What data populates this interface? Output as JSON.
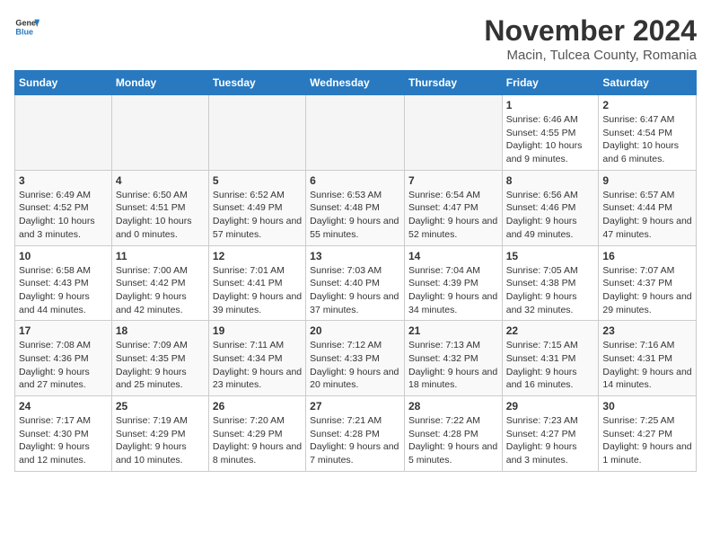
{
  "header": {
    "logo_general": "General",
    "logo_blue": "Blue",
    "month": "November 2024",
    "location": "Macin, Tulcea County, Romania"
  },
  "weekdays": [
    "Sunday",
    "Monday",
    "Tuesday",
    "Wednesday",
    "Thursday",
    "Friday",
    "Saturday"
  ],
  "weeks": [
    [
      {
        "day": "",
        "info": ""
      },
      {
        "day": "",
        "info": ""
      },
      {
        "day": "",
        "info": ""
      },
      {
        "day": "",
        "info": ""
      },
      {
        "day": "",
        "info": ""
      },
      {
        "day": "1",
        "info": "Sunrise: 6:46 AM\nSunset: 4:55 PM\nDaylight: 10 hours and 9 minutes."
      },
      {
        "day": "2",
        "info": "Sunrise: 6:47 AM\nSunset: 4:54 PM\nDaylight: 10 hours and 6 minutes."
      }
    ],
    [
      {
        "day": "3",
        "info": "Sunrise: 6:49 AM\nSunset: 4:52 PM\nDaylight: 10 hours and 3 minutes."
      },
      {
        "day": "4",
        "info": "Sunrise: 6:50 AM\nSunset: 4:51 PM\nDaylight: 10 hours and 0 minutes."
      },
      {
        "day": "5",
        "info": "Sunrise: 6:52 AM\nSunset: 4:49 PM\nDaylight: 9 hours and 57 minutes."
      },
      {
        "day": "6",
        "info": "Sunrise: 6:53 AM\nSunset: 4:48 PM\nDaylight: 9 hours and 55 minutes."
      },
      {
        "day": "7",
        "info": "Sunrise: 6:54 AM\nSunset: 4:47 PM\nDaylight: 9 hours and 52 minutes."
      },
      {
        "day": "8",
        "info": "Sunrise: 6:56 AM\nSunset: 4:46 PM\nDaylight: 9 hours and 49 minutes."
      },
      {
        "day": "9",
        "info": "Sunrise: 6:57 AM\nSunset: 4:44 PM\nDaylight: 9 hours and 47 minutes."
      }
    ],
    [
      {
        "day": "10",
        "info": "Sunrise: 6:58 AM\nSunset: 4:43 PM\nDaylight: 9 hours and 44 minutes."
      },
      {
        "day": "11",
        "info": "Sunrise: 7:00 AM\nSunset: 4:42 PM\nDaylight: 9 hours and 42 minutes."
      },
      {
        "day": "12",
        "info": "Sunrise: 7:01 AM\nSunset: 4:41 PM\nDaylight: 9 hours and 39 minutes."
      },
      {
        "day": "13",
        "info": "Sunrise: 7:03 AM\nSunset: 4:40 PM\nDaylight: 9 hours and 37 minutes."
      },
      {
        "day": "14",
        "info": "Sunrise: 7:04 AM\nSunset: 4:39 PM\nDaylight: 9 hours and 34 minutes."
      },
      {
        "day": "15",
        "info": "Sunrise: 7:05 AM\nSunset: 4:38 PM\nDaylight: 9 hours and 32 minutes."
      },
      {
        "day": "16",
        "info": "Sunrise: 7:07 AM\nSunset: 4:37 PM\nDaylight: 9 hours and 29 minutes."
      }
    ],
    [
      {
        "day": "17",
        "info": "Sunrise: 7:08 AM\nSunset: 4:36 PM\nDaylight: 9 hours and 27 minutes."
      },
      {
        "day": "18",
        "info": "Sunrise: 7:09 AM\nSunset: 4:35 PM\nDaylight: 9 hours and 25 minutes."
      },
      {
        "day": "19",
        "info": "Sunrise: 7:11 AM\nSunset: 4:34 PM\nDaylight: 9 hours and 23 minutes."
      },
      {
        "day": "20",
        "info": "Sunrise: 7:12 AM\nSunset: 4:33 PM\nDaylight: 9 hours and 20 minutes."
      },
      {
        "day": "21",
        "info": "Sunrise: 7:13 AM\nSunset: 4:32 PM\nDaylight: 9 hours and 18 minutes."
      },
      {
        "day": "22",
        "info": "Sunrise: 7:15 AM\nSunset: 4:31 PM\nDaylight: 9 hours and 16 minutes."
      },
      {
        "day": "23",
        "info": "Sunrise: 7:16 AM\nSunset: 4:31 PM\nDaylight: 9 hours and 14 minutes."
      }
    ],
    [
      {
        "day": "24",
        "info": "Sunrise: 7:17 AM\nSunset: 4:30 PM\nDaylight: 9 hours and 12 minutes."
      },
      {
        "day": "25",
        "info": "Sunrise: 7:19 AM\nSunset: 4:29 PM\nDaylight: 9 hours and 10 minutes."
      },
      {
        "day": "26",
        "info": "Sunrise: 7:20 AM\nSunset: 4:29 PM\nDaylight: 9 hours and 8 minutes."
      },
      {
        "day": "27",
        "info": "Sunrise: 7:21 AM\nSunset: 4:28 PM\nDaylight: 9 hours and 7 minutes."
      },
      {
        "day": "28",
        "info": "Sunrise: 7:22 AM\nSunset: 4:28 PM\nDaylight: 9 hours and 5 minutes."
      },
      {
        "day": "29",
        "info": "Sunrise: 7:23 AM\nSunset: 4:27 PM\nDaylight: 9 hours and 3 minutes."
      },
      {
        "day": "30",
        "info": "Sunrise: 7:25 AM\nSunset: 4:27 PM\nDaylight: 9 hours and 1 minute."
      }
    ]
  ]
}
